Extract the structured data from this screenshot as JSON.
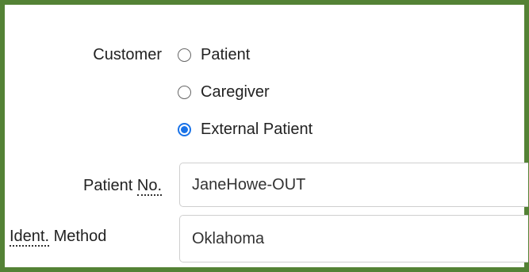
{
  "form": {
    "customer_label": "Customer",
    "customer_options": [
      {
        "label": "Patient",
        "selected": false
      },
      {
        "label": "Caregiver",
        "selected": false
      },
      {
        "label": "External Patient",
        "selected": true
      }
    ],
    "patient_no_label_prefix": "Patient ",
    "patient_no_label_abbr": "No.",
    "patient_no_value": "JaneHowe-OUT",
    "ident_method_label_abbr": "Ident.",
    "ident_method_label_suffix": " Method",
    "ident_method_value": "Oklahoma"
  },
  "colors": {
    "frame_border": "#548235",
    "radio_selected": "#1a73e8"
  }
}
